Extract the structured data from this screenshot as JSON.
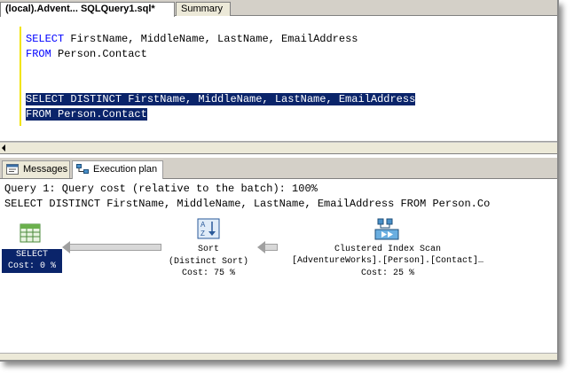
{
  "editor_tabs": [
    {
      "label": "(local).Advent... SQLQuery1.sql*",
      "active": true
    },
    {
      "label": "Summary",
      "active": false
    }
  ],
  "editor": {
    "query1": {
      "select_kw": "SELECT",
      "select_cols": " FirstName, MiddleName, LastName, EmailAddress",
      "from_kw": "FROM",
      "from_table": " Person.Contact"
    },
    "query2": {
      "line1": "SELECT DISTINCT FirstName, MiddleName, LastName, EmailAddress",
      "line2": "FROM Person.Contact"
    }
  },
  "result_tabs": [
    {
      "label": "Messages",
      "icon": "messages-icon",
      "active": false
    },
    {
      "label": "Execution plan",
      "icon": "execution-plan-icon",
      "active": true
    }
  ],
  "plan": {
    "header": "Query 1: Query cost (relative to the batch): 100%",
    "statement": "SELECT DISTINCT FirstName, MiddleName, LastName, EmailAddress FROM Person.Co",
    "nodes": {
      "select": {
        "name": "SELECT",
        "cost": "Cost: 0 %",
        "icon": "select-result-icon"
      },
      "sort": {
        "name": "Sort",
        "detail": "(Distinct Sort)",
        "cost": "Cost: 75 %",
        "icon": "sort-icon"
      },
      "scan": {
        "name": "Clustered Index Scan",
        "detail": "[AdventureWorks].[Person].[Contact]…",
        "cost": "Cost: 25 %",
        "icon": "clustered-index-scan-icon"
      }
    }
  },
  "colors": {
    "keyword": "#0000ff",
    "selection": "#0a246a",
    "chrome": "#d4d0c8"
  }
}
